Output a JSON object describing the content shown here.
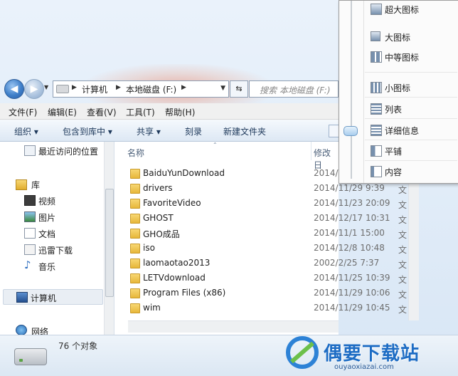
{
  "address_bar": {
    "crumbs": [
      "计算机",
      "本地磁盘 (F:)"
    ],
    "search_placeholder": "搜索 本地磁盘 (F:)"
  },
  "menu": [
    "文件(F)",
    "编辑(E)",
    "查看(V)",
    "工具(T)",
    "帮助(H)"
  ],
  "toolbar": [
    "组织",
    "包含到库中",
    "共享",
    "刻录",
    "新建文件夹"
  ],
  "nav_pane": {
    "recent": "最近访问的位置",
    "library": "库",
    "library_items": [
      "视频",
      "图片",
      "文档",
      "迅雷下载",
      "音乐"
    ],
    "computer": "计算机",
    "network": "网络"
  },
  "file_list": {
    "col_name": "名称",
    "col_date": "修改日",
    "rows": [
      {
        "name": "BaiduYunDownload",
        "date": "2014/",
        "type": ""
      },
      {
        "name": "drivers",
        "date": "2014/11/29 9:39",
        "type": "文"
      },
      {
        "name": "FavoriteVideo",
        "date": "2014/11/23 20:09",
        "type": "文"
      },
      {
        "name": "GHOST",
        "date": "2014/12/17 10:31",
        "type": "文"
      },
      {
        "name": "GHO成品",
        "date": "2014/11/1 15:00",
        "type": "文"
      },
      {
        "name": "iso",
        "date": "2014/12/8 10:48",
        "type": "文"
      },
      {
        "name": "laomaotao2013",
        "date": "2002/2/25 7:37",
        "type": "文"
      },
      {
        "name": "LETVdownload",
        "date": "2014/11/25 10:39",
        "type": "文"
      },
      {
        "name": "Program Files (x86)",
        "date": "2014/11/29 10:06",
        "type": "文"
      },
      {
        "name": "wim",
        "date": "2014/11/29 10:45",
        "type": "文"
      }
    ]
  },
  "status": {
    "count": "76 个对象"
  },
  "view_menu": {
    "options": [
      "超大图标",
      "大图标",
      "中等图标",
      "小图标",
      "列表",
      "详细信息",
      "平铺",
      "内容"
    ],
    "selected": "详细信息"
  },
  "watermark": {
    "brand": "偶要下载站",
    "url": "ouyaoxiazai.com"
  }
}
